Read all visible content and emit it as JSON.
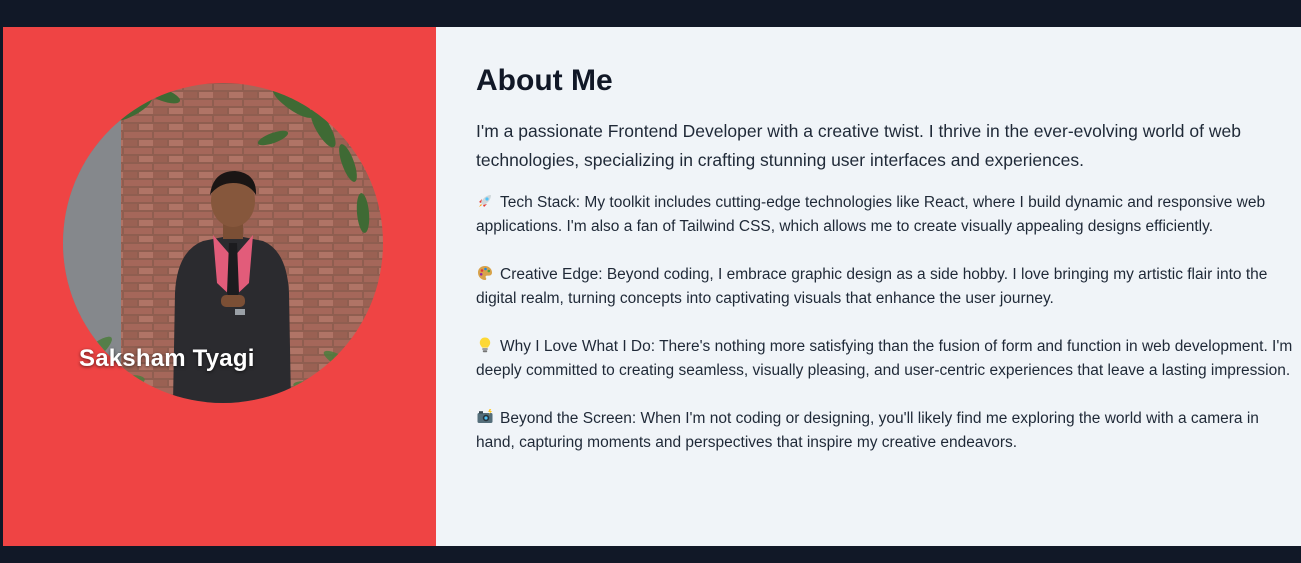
{
  "colors": {
    "page_bg": "#111827",
    "left_panel": "#ef4444",
    "right_panel": "#f0f4f8",
    "heading_text": "#111827",
    "body_text": "#1f2937",
    "name_text": "#ffffff"
  },
  "profile": {
    "name": "Saksham Tyagi",
    "photo": "profile-photo-brick-wall-suit"
  },
  "about": {
    "title": "About Me",
    "intro": "I'm a passionate Frontend Developer with a creative twist. I thrive in the ever-evolving world of web technologies, specializing in crafting stunning user interfaces and experiences.",
    "points": [
      {
        "icon": "rocket-icon",
        "text": "Tech Stack: My toolkit includes cutting-edge technologies like React, where I build dynamic and responsive web applications. I'm also a fan of Tailwind CSS, which allows me to create visually appealing designs efficiently."
      },
      {
        "icon": "palette-icon",
        "text": "Creative Edge: Beyond coding, I embrace graphic design as a side hobby. I love bringing my artistic flair into the digital realm, turning concepts into captivating visuals that enhance the user journey."
      },
      {
        "icon": "lightbulb-icon",
        "text": "Why I Love What I Do: There's nothing more satisfying than the fusion of form and function in web development. I'm deeply committed to creating seamless, visually pleasing, and user-centric experiences that leave a lasting impression."
      },
      {
        "icon": "camera-flash-icon",
        "text": "Beyond the Screen: When I'm not coding or designing, you'll likely find me exploring the world with a camera in hand, capturing moments and perspectives that inspire my creative endeavors."
      }
    ]
  }
}
